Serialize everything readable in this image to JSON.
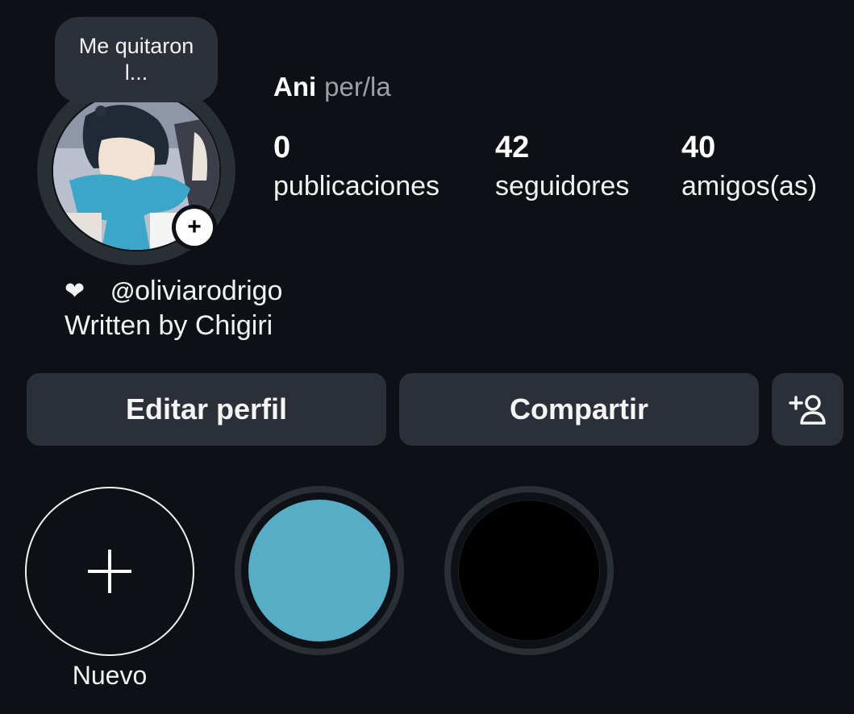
{
  "note": {
    "text": "Me quitaron l..."
  },
  "profile": {
    "name": "Ani",
    "pronouns": "per/la",
    "add_story_symbol": "+"
  },
  "stats": [
    {
      "value": "0",
      "label": "publicaciones"
    },
    {
      "value": "42",
      "label": "seguidores"
    },
    {
      "value": "40",
      "label": "amigos(as)"
    }
  ],
  "bio": {
    "heart_icon": "❤",
    "threads_icon": "@",
    "threads_handle": "oliviarodrigo",
    "line2": "Written by Chigiri"
  },
  "buttons": {
    "edit": "Editar perfil",
    "share": "Compartir",
    "add_user_icon": "add-person-icon"
  },
  "highlights": [
    {
      "label": "Nuevo",
      "type": "new"
    },
    {
      "label": "",
      "color": "#57acc6"
    },
    {
      "label": "",
      "color": "#000000"
    }
  ],
  "colors": {
    "background": "#0d1015",
    "button_bg": "#2b2f37",
    "muted_text": "#9aa0aa",
    "ring": "#2a2e35"
  }
}
